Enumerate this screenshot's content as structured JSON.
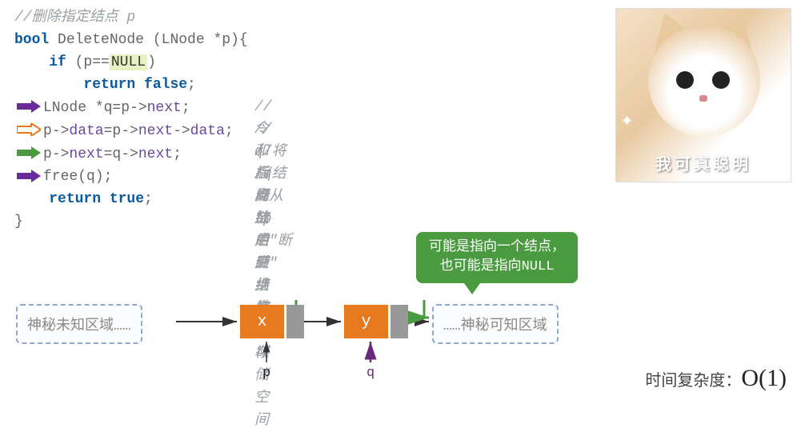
{
  "code": {
    "comment_header": "//删除指定结点 p",
    "line_bool": "bool",
    "line_func": " DeleteNode (LNode *p){",
    "line_if_kw": "if",
    "line_if_rest": " (p==",
    "line_if_null": "NULL",
    "line_if_close": ")",
    "line_return_false_kw": "return false",
    "line_return_false_semi": ";",
    "line_q_decl_type": "LNode ",
    "line_q_decl_rest": "*q=p->",
    "line_q_decl_next": "next",
    "line_q_decl_semi": ";",
    "line_swap_p": "p->",
    "line_swap_data1": "data",
    "line_swap_eq": "=p->",
    "line_swap_next": "next",
    "line_swap_arrow": "->",
    "line_swap_data2": "data",
    "line_swap_semi": ";",
    "line_pnxt_p": "p->",
    "line_pnxt_next1": "next",
    "line_pnxt_eq": "=q->",
    "line_pnxt_next2": "next",
    "line_pnxt_semi": ";",
    "line_free": "free(q);",
    "line_return_true_kw": "return true",
    "line_return_true_semi": ";",
    "line_close": "}",
    "side_comments": {
      "c1": "//令q指向*p的后继结点",
      "c2": "//和后继结点交换数据域",
      "c3": "//将*q结点从链中\"断开\"",
      "c4": "//释放后继结点的存储空间"
    }
  },
  "arrows": {
    "colors": {
      "solid_purple": "#6a2a9a",
      "hollow_orange": "#e77a1f",
      "solid_green": "#4a9a3f"
    }
  },
  "cat": {
    "caption": "我可真聪明"
  },
  "bubble": {
    "line1": "可能是指向一个结点，",
    "line2": "也可能是指向NULL"
  },
  "diagram": {
    "left_region": "神秘未知区域……",
    "right_region": "……神秘可知区域",
    "node_x": "x",
    "node_y": "y",
    "ptr_p": "p",
    "ptr_q": "q"
  },
  "complexity": {
    "label": "时间复杂度：",
    "value": "O(1)"
  }
}
